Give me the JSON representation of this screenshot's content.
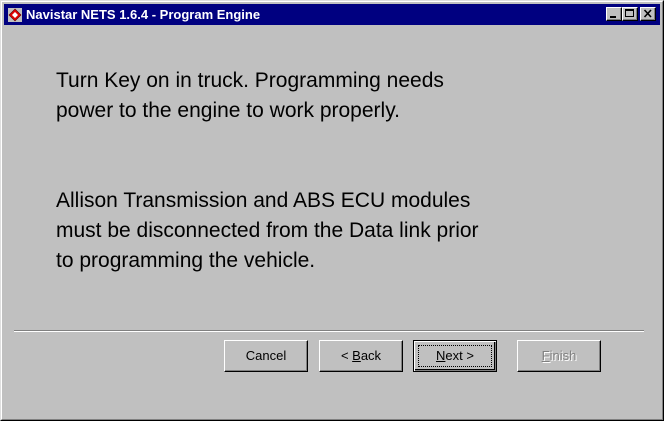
{
  "window": {
    "title": "Navistar NETS 1.6.4 - Program Engine",
    "icon": "navistar-diamond-icon",
    "controls": [
      "minimize",
      "maximize",
      "close"
    ]
  },
  "messages": [
    {
      "lines": [
        "Turn Key on in truck.  Programming needs",
        "power to the engine to work properly."
      ]
    },
    {
      "lines": [
        "Allison Transmission and ABS ECU modules",
        "must be disconnected from the Data link prior",
        "to programming the vehicle."
      ]
    }
  ],
  "buttons": {
    "cancel": {
      "label": "Cancel",
      "enabled": true
    },
    "back": {
      "arrow": "<",
      "accel": "B",
      "rest": "ack",
      "enabled": true
    },
    "next": {
      "accel": "N",
      "rest": "ext",
      "arrow": ">",
      "enabled": true,
      "default": true
    },
    "finish": {
      "accel": "F",
      "rest": "inish",
      "enabled": false
    }
  },
  "colors": {
    "titlebar": "#000080",
    "face": "#c0c0c0",
    "icon_red": "#e00000"
  }
}
